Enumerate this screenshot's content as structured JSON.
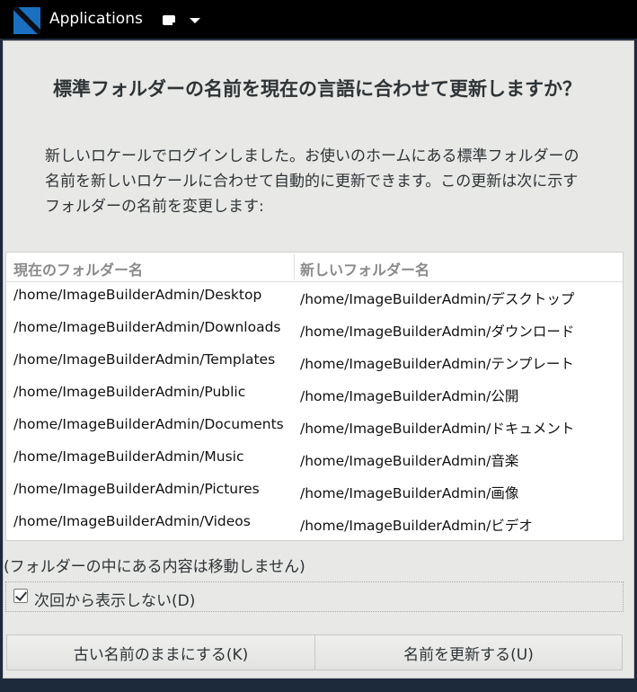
{
  "taskbar": {
    "app_menu_label": "Applications",
    "logo_icon": "distro-logo-icon",
    "window_icon": "window-list-icon",
    "dropdown_icon": "chevron-down-icon"
  },
  "dialog": {
    "title": "標準フォルダーの名前を現在の言語に合わせて更新しますか？",
    "description": "新しいロケールでログインしました。お使いのホームにある標準フォルダーの名前を新しいロケールに合わせて自動的に更新できます。この更新は次に示すフォルダーの名前を変更します:",
    "table": {
      "columns": [
        "現在のフォルダー名",
        "新しいフォルダー名"
      ],
      "rows": [
        [
          "/home/ImageBuilderAdmin/Desktop",
          "/home/ImageBuilderAdmin/デスクトップ"
        ],
        [
          "/home/ImageBuilderAdmin/Downloads",
          "/home/ImageBuilderAdmin/ダウンロード"
        ],
        [
          "/home/ImageBuilderAdmin/Templates",
          "/home/ImageBuilderAdmin/テンプレート"
        ],
        [
          "/home/ImageBuilderAdmin/Public",
          "/home/ImageBuilderAdmin/公開"
        ],
        [
          "/home/ImageBuilderAdmin/Documents",
          "/home/ImageBuilderAdmin/ドキュメント"
        ],
        [
          "/home/ImageBuilderAdmin/Music",
          "/home/ImageBuilderAdmin/音楽"
        ],
        [
          "/home/ImageBuilderAdmin/Pictures",
          "/home/ImageBuilderAdmin/画像"
        ],
        [
          "/home/ImageBuilderAdmin/Videos",
          "/home/ImageBuilderAdmin/ビデオ"
        ]
      ]
    },
    "note": "(フォルダーの中にある内容は移動しません)",
    "checkbox": {
      "label": "次回から表示しない(D)",
      "checked": true
    },
    "buttons": {
      "keep_label": "古い名前のままにする(K)",
      "update_label": "名前を更新する(U)"
    }
  },
  "colors": {
    "taskbar_bg": "#000000",
    "desktop_bg": "#1d2a3b",
    "dialog_bg": "#e8e8e7",
    "logo_blue": "#1a6fc1"
  }
}
